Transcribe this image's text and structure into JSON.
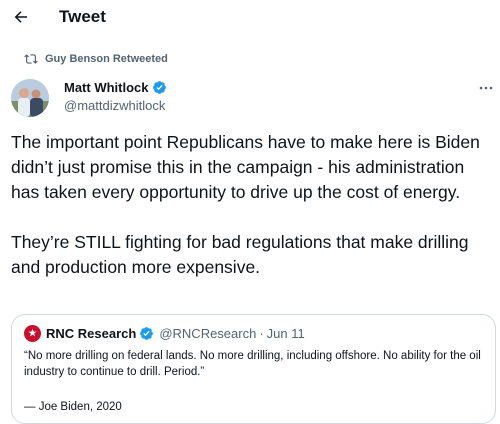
{
  "header": {
    "title": "Tweet"
  },
  "social_context": {
    "text": "Guy Benson Retweeted"
  },
  "author": {
    "name": "Matt Whitlock",
    "handle": "@mattdizwhitlock"
  },
  "tweet": {
    "paragraphs": [
      "The important point Republicans have to make here is Biden didn’t just promise this in the campaign - his administration has taken every opportunity to drive up the cost of energy.",
      "They’re STILL fighting for bad regulations that make drilling and production more expensive."
    ]
  },
  "quoted_tweet": {
    "author_name": "RNC Research",
    "author_handle": "@RNCResearch",
    "separator": "·",
    "date": "Jun 11",
    "text": "“No more drilling on federal lands. No more drilling, including offshore. No ability for the oil industry to continue to drill. Period.”",
    "attribution": "— Joe Biden, 2020"
  },
  "colors": {
    "accent": "#1d9bf0",
    "secondary_text": "#536471",
    "border": "#cfd9de",
    "rnc_red": "#c8102e"
  },
  "icons": {
    "back": "arrow-left-icon",
    "retweet": "retweet-icon",
    "verified": "verified-badge-icon",
    "more": "more-horizontal-icon"
  }
}
